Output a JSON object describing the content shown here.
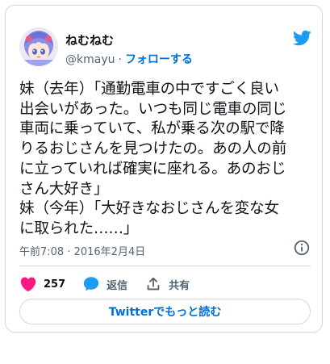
{
  "user": {
    "display_name": "ねむねむ",
    "handle": "@kmayu",
    "separator": "·",
    "follow_label": "フォローする",
    "avatar_icon": "anime-girl-avatar",
    "brand_icon": "twitter-bird-icon"
  },
  "tweet": {
    "text": "妹（去年）「通勤電車の中ですごく良い\n出会いがあった。いつも同じ電車の同じ\n車両に乗っていて、私が乗る次の駅で降\nりるおじさんを見つけたの。あの人の前\nに立っていれば確実に座れる。あのおじ\nさん大好き」\n妹（今年）「大好きなおじさんを変な女\nに取られた……」",
    "timestamp": "午前7:08 · 2016年2月4日"
  },
  "actions": {
    "like_count": "257",
    "reply_label": "返信",
    "share_label": "共有"
  },
  "footer": {
    "read_more_label": "Twitterでもっと読む"
  },
  "colors": {
    "accent": "#006fd6",
    "twitter_blue": "#1d9bf0",
    "like_red": "#f91880",
    "text": "#0f1419",
    "muted": "#536471",
    "border": "#cfd9de"
  }
}
